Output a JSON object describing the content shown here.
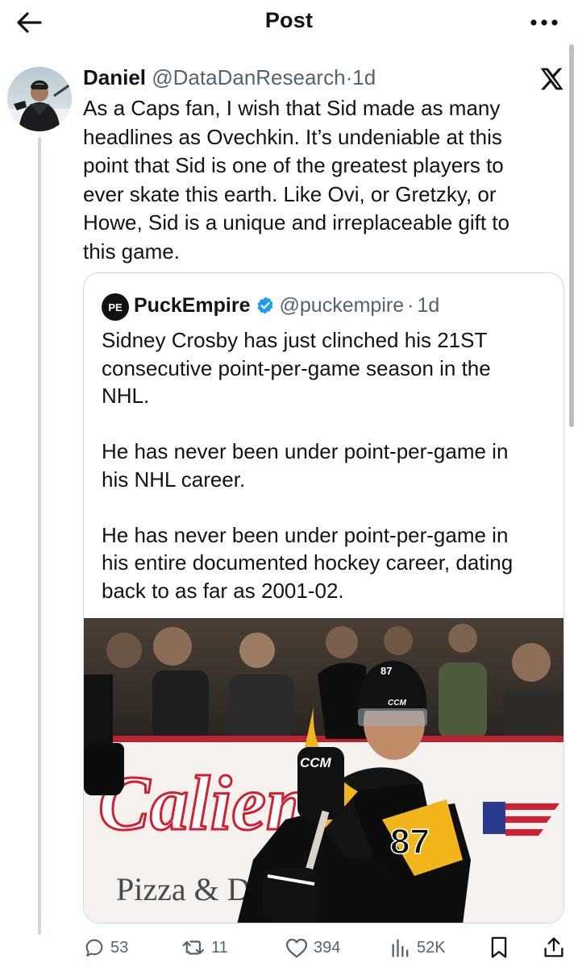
{
  "header": {
    "title": "Post",
    "back_icon": "arrow-left-icon",
    "more_icon": "more-horizontal-icon"
  },
  "post": {
    "author_name": "Daniel",
    "author_handle": "@DataDanResearch",
    "separator": "·",
    "time": "1d",
    "platform_icon": "x-logo-icon",
    "text": "As a Caps fan, I wish that Sid made as many\nheadlines as Ovechkin. It’s undeniable at this\npoint that Sid is one of the greatest players to\never skate this earth. Like Ovi, or Gretzky, or\nHowe, Sid is a unique and irreplaceable gift to\nthis game."
  },
  "quote": {
    "avatar_text": "PE",
    "author_name": "PuckEmpire",
    "author_handle": "@puckempire",
    "separator": "·",
    "time": "1d",
    "verified_icon": "verified-badge-icon",
    "text": "Sidney Crosby has just clinched his 21ST\nconsecutive point-per-game season in the\nNHL.\n\nHe has never been under point-per-game in\nhis NHL career.\n\nHe has never been under point-per-game in\nhis entire documented hockey career, dating\nback to as far as 2001-02.",
    "image": {
      "sign_text": "Calien",
      "sign_subtext": "Pizza & Dr",
      "jersey_number": "87",
      "helmet_number": "87",
      "helmet_brand": "CCM",
      "glove_brand": "CCM"
    }
  },
  "actions": {
    "replies": "53",
    "reposts": "11",
    "likes": "394",
    "views": "52K"
  },
  "colors": {
    "text": "#0f1419",
    "secondary": "#536471",
    "border": "#cfd9de",
    "verified": "#1d9bf0",
    "penguins_gold": "#f2b51c"
  }
}
